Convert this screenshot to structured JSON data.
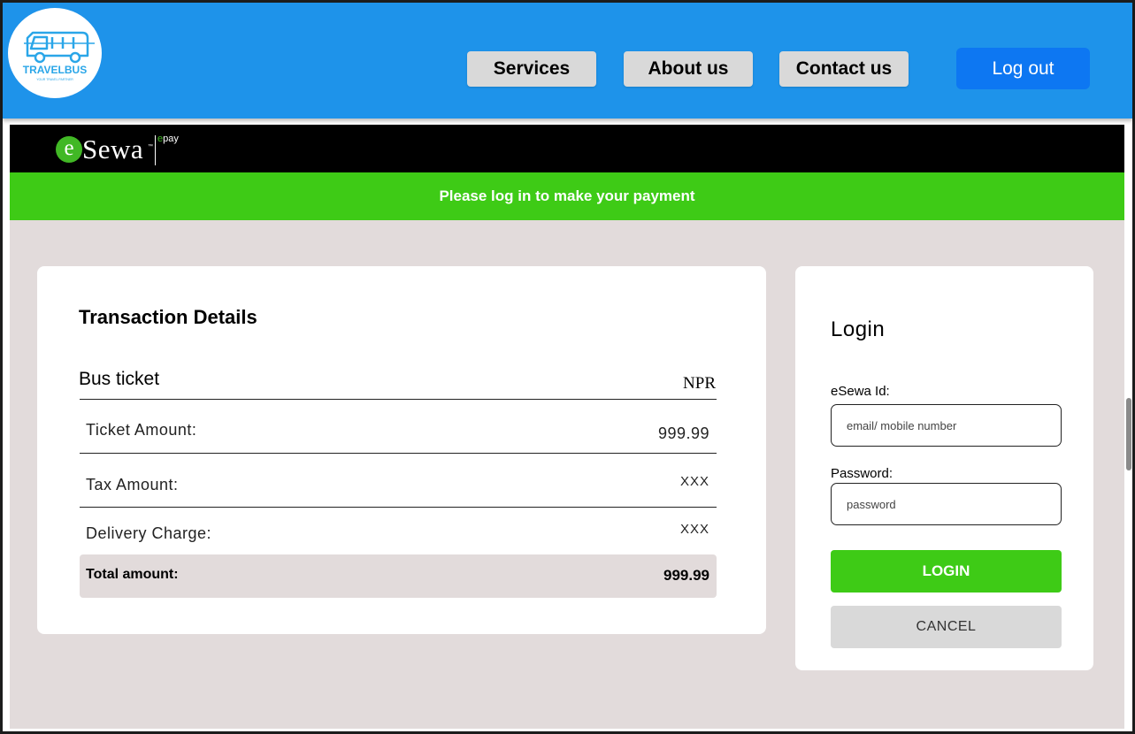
{
  "header": {
    "logo_text": "TRAVELBUS",
    "logo_tagline": "YOUR TRAVEL PARTNER",
    "nav": {
      "services": "Services",
      "about": "About us",
      "contact": "Contact us"
    },
    "logout_label": "Log out",
    "colors": {
      "bar": "#1e93ea",
      "logout": "#0d77f2"
    }
  },
  "esewa": {
    "logo_e": "e",
    "logo_word": "Sewa",
    "logo_tm": "™",
    "epay_e": "e",
    "epay_rest": "pay",
    "banner": "Please log in to make your payment",
    "colors": {
      "green": "#3ecb16",
      "black": "#000000"
    }
  },
  "transaction": {
    "title": "Transaction Details",
    "item": "Bus ticket",
    "currency": "NPR",
    "rows": [
      {
        "label": "Ticket Amount:",
        "value": "999.99"
      },
      {
        "label": "Tax Amount:",
        "value": "XXX"
      },
      {
        "label": "Delivery Charge:",
        "value": "XXX"
      }
    ],
    "total_label": "Total amount:",
    "total_value": "999.99"
  },
  "login": {
    "title": "Login",
    "id_label": "eSewa Id:",
    "id_placeholder": "email/ mobile number",
    "password_label": "Password:",
    "password_placeholder": "password",
    "login_button": "LOGIN",
    "cancel_button": "CANCEL"
  }
}
